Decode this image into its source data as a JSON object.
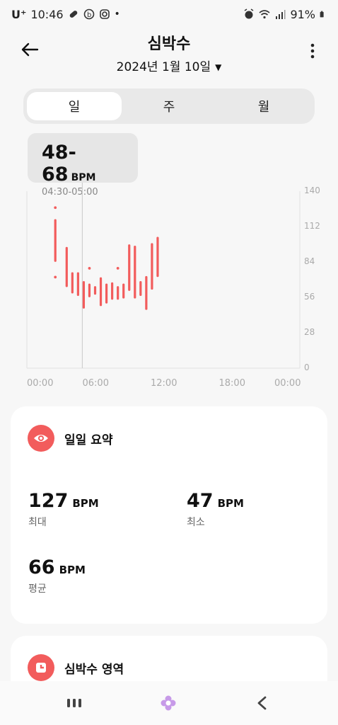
{
  "status_bar": {
    "carrier": "U⁺",
    "time": "10:46",
    "dot": "•",
    "battery": "91%",
    "icons": [
      "pill-icon",
      "b-icon",
      "instagram-icon",
      "alarm-icon",
      "wifi-icon",
      "signal-icon",
      "battery-icon"
    ]
  },
  "header": {
    "title": "심박수",
    "date": "2024년 1월 10일",
    "caret": "▼"
  },
  "tabs": [
    {
      "label": "일",
      "active": true
    },
    {
      "label": "주",
      "active": false
    },
    {
      "label": "월",
      "active": false
    }
  ],
  "tooltip": {
    "range": "48-68",
    "unit": "BPM",
    "time": "04:30-05:00"
  },
  "chart_data": {
    "type": "bar",
    "y_ticks": [
      "140",
      "112",
      "84",
      "56",
      "28",
      "0"
    ],
    "x_ticks": [
      "00:00",
      "06:00",
      "12:00",
      "18:00",
      "00:00"
    ],
    "ylim": [
      0,
      140
    ],
    "xlim": [
      0,
      24
    ],
    "color": "#f25c5c",
    "selected_hour": 5,
    "ranges": [
      {
        "t": 2.5,
        "lo": 85,
        "hi": 117
      },
      {
        "t": 3.5,
        "lo": 65,
        "hi": 95
      },
      {
        "t": 4.0,
        "lo": 60,
        "hi": 75
      },
      {
        "t": 4.5,
        "lo": 58,
        "hi": 75
      },
      {
        "t": 5.0,
        "lo": 48,
        "hi": 68
      },
      {
        "t": 5.5,
        "lo": 57,
        "hi": 66
      },
      {
        "t": 6.0,
        "lo": 59,
        "hi": 64
      },
      {
        "t": 6.5,
        "lo": 50,
        "hi": 71
      },
      {
        "t": 7.0,
        "lo": 52,
        "hi": 66
      },
      {
        "t": 7.5,
        "lo": 55,
        "hi": 67
      },
      {
        "t": 8.0,
        "lo": 55,
        "hi": 64
      },
      {
        "t": 8.5,
        "lo": 56,
        "hi": 66
      },
      {
        "t": 9.0,
        "lo": 62,
        "hi": 97
      },
      {
        "t": 9.5,
        "lo": 56,
        "hi": 96
      },
      {
        "t": 10.0,
        "lo": 58,
        "hi": 68
      },
      {
        "t": 10.5,
        "lo": 47,
        "hi": 72
      },
      {
        "t": 11.0,
        "lo": 63,
        "hi": 98
      },
      {
        "t": 11.5,
        "lo": 73,
        "hi": 103
      }
    ],
    "dots": [
      {
        "t": 2.5,
        "v": 127
      },
      {
        "t": 2.5,
        "v": 72
      },
      {
        "t": 5.5,
        "v": 79
      },
      {
        "t": 8.0,
        "v": 79
      }
    ]
  },
  "summary": {
    "title": "일일 요약",
    "max": {
      "value": "127",
      "unit": "BPM",
      "label": "최대"
    },
    "min": {
      "value": "47",
      "unit": "BPM",
      "label": "최소"
    },
    "avg": {
      "value": "66",
      "unit": "BPM",
      "label": "평균"
    }
  },
  "zones": {
    "title": "심박수 영역"
  }
}
